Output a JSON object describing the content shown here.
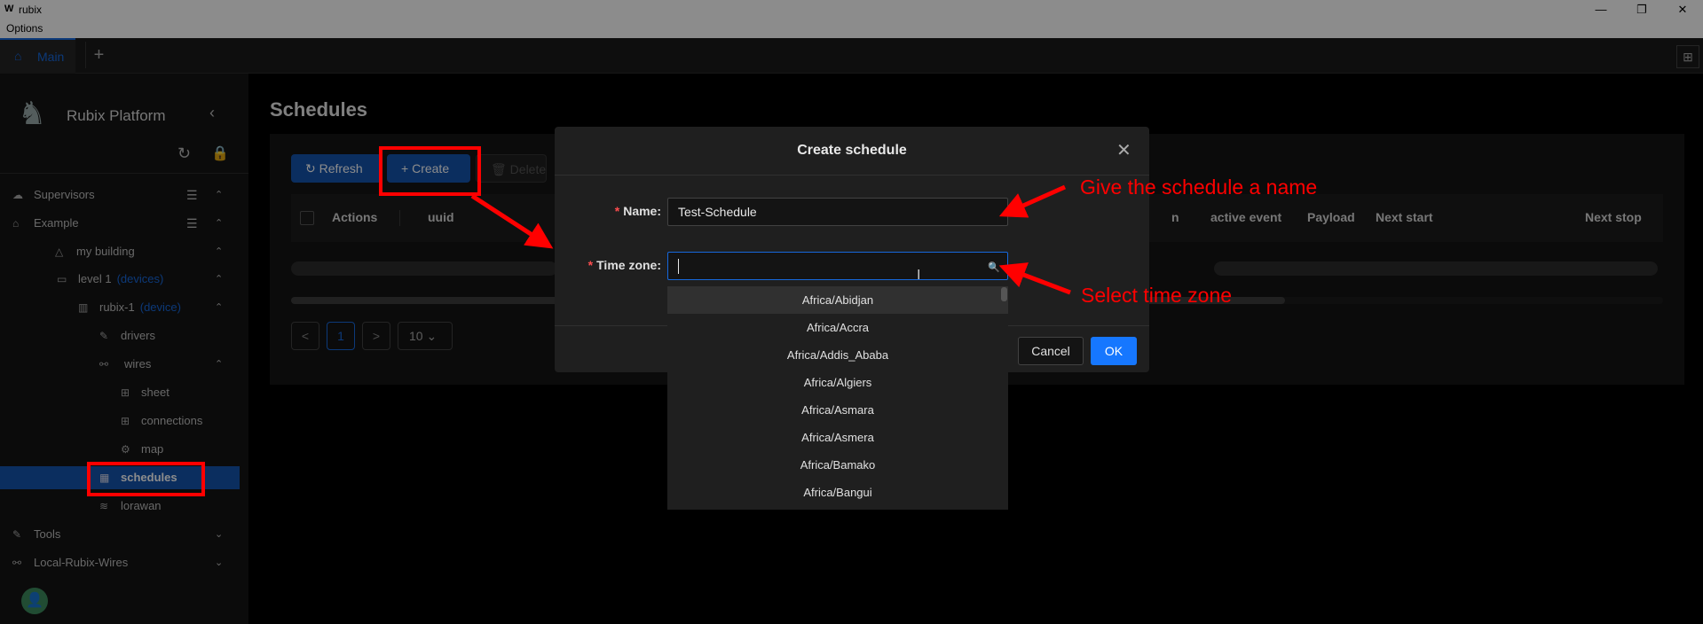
{
  "window": {
    "title": "rubix",
    "logo": "W",
    "minimize": "—",
    "restore": "❐",
    "close": "✕"
  },
  "menubar": {
    "options": "Options"
  },
  "tabs": {
    "main": "Main",
    "add": "+",
    "layout_icon": "⊞"
  },
  "sidebar": {
    "brand": "Rubix Platform",
    "nodes": [
      {
        "label": "Supervisors",
        "tag": ""
      },
      {
        "label": "Example",
        "tag": ""
      },
      {
        "label": "my building",
        "tag": ""
      },
      {
        "label": "level 1",
        "tag": "(devices)"
      },
      {
        "label": "rubix-1",
        "tag": "(device)"
      },
      {
        "label": "drivers",
        "tag": ""
      },
      {
        "label": "wires",
        "tag": ""
      },
      {
        "label": "sheet",
        "tag": ""
      },
      {
        "label": "connections",
        "tag": ""
      },
      {
        "label": "map",
        "tag": ""
      },
      {
        "label": "schedules",
        "tag": ""
      },
      {
        "label": "lorawan",
        "tag": ""
      },
      {
        "label": "Tools",
        "tag": ""
      },
      {
        "label": "Local-Rubix-Wires",
        "tag": ""
      }
    ]
  },
  "main": {
    "title": "Schedules",
    "toolbar": {
      "refresh": "Refresh",
      "create": "Create",
      "delete": "Delete"
    },
    "columns": {
      "actions": "Actions",
      "uuid": "uuid",
      "n": "n",
      "active_event": "active event",
      "payload": "Payload",
      "next_start": "Next start",
      "next_stop": "Next stop"
    },
    "pagination": {
      "prev": "<",
      "current": "1",
      "next": ">",
      "page_size": "10"
    }
  },
  "modal": {
    "title": "Create schedule",
    "name_label": "Name:",
    "name_value": "Test-Schedule",
    "timezone_label": "Time zone:",
    "timezone_value": "",
    "cancel": "Cancel",
    "ok": "OK",
    "timezone_options": [
      "Africa/Abidjan",
      "Africa/Accra",
      "Africa/Addis_Ababa",
      "Africa/Algiers",
      "Africa/Asmara",
      "Africa/Asmera",
      "Africa/Bamako",
      "Africa/Bangui"
    ]
  },
  "annotations": {
    "name_hint": "Give the schedule a name",
    "timezone_hint": "Select time zone"
  },
  "colors": {
    "accent": "#1668dc",
    "annotation": "#ff0000",
    "active_bg": "#1554ad"
  }
}
